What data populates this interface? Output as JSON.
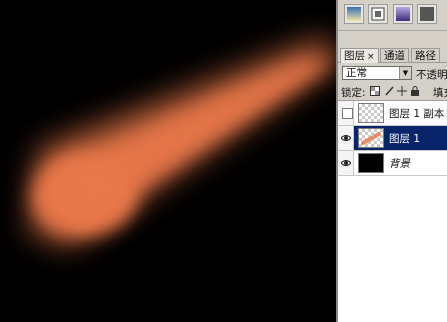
{
  "colors": {
    "brush": "#e8774a",
    "panel_bg": "#d4d0c8",
    "selected_row": "#0a246a"
  },
  "toolbar": {
    "icons": [
      "gradient-tool-icon",
      "stamp-tool-icon",
      "swatch-purple-icon",
      "swatch-gray-icon"
    ]
  },
  "tabs": [
    {
      "label": "图层",
      "close": "×"
    },
    {
      "label": "通道"
    },
    {
      "label": "路径"
    }
  ],
  "blend": {
    "mode": "正常",
    "arrow": "▼",
    "opacity_label": "不透明度"
  },
  "lock": {
    "label": "锁定:",
    "fill_label": "填充"
  },
  "layers": [
    {
      "name": "图层 1 副本",
      "visible": false,
      "selected": false
    },
    {
      "name": "图层 1",
      "visible": true,
      "selected": true
    },
    {
      "name": "背景",
      "visible": true,
      "selected": false
    }
  ]
}
